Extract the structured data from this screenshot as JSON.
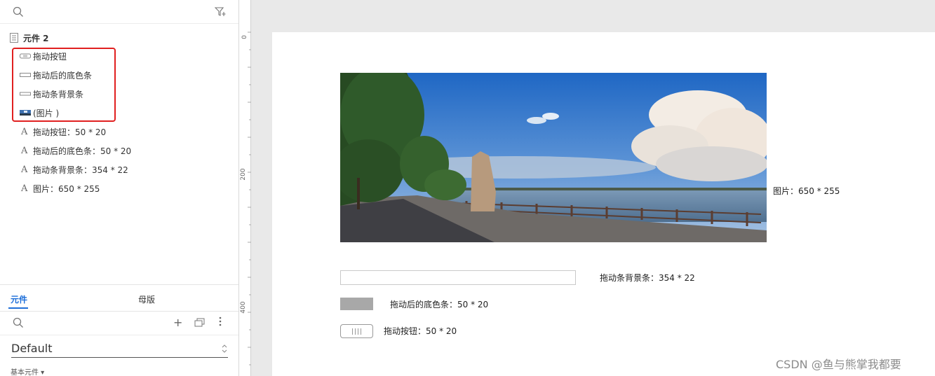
{
  "outline": {
    "page_title": "元件 2",
    "widgets": [
      {
        "label": "拖动按钮",
        "icon": "button-shape-icon"
      },
      {
        "label": "拖动后的底色条",
        "icon": "rectangle-shape-icon"
      },
      {
        "label": "拖动条背景条",
        "icon": "rectangle-shape-icon"
      },
      {
        "label": "(图片 )",
        "icon": "image-icon"
      }
    ],
    "text_items": [
      {
        "label": "拖动按钮：50 * 20"
      },
      {
        "label": "拖动后的底色条：50 * 20"
      },
      {
        "label": "拖动条背景条：354 * 22"
      },
      {
        "label": "图片：650 * 255"
      }
    ]
  },
  "library": {
    "tabs": [
      {
        "label": "元件",
        "active": true
      },
      {
        "label": "母版",
        "active": false
      }
    ],
    "selected_library": "Default",
    "group_label": "基本元件 ▾"
  },
  "ruler": {
    "labels": [
      "0",
      "200",
      "400"
    ]
  },
  "canvas": {
    "image_caption": "图片：650 * 255",
    "track_caption": "拖动条背景条：354 * 22",
    "fill_caption": "拖动后的底色条：50 * 20",
    "handle_caption": "拖动按钮：50 * 20"
  },
  "watermark": "CSDN @鱼与熊掌我都要",
  "colors": {
    "accent": "#1e6fd9",
    "highlight_box": "#e02020",
    "fill_bar": "#a8a8a8"
  }
}
